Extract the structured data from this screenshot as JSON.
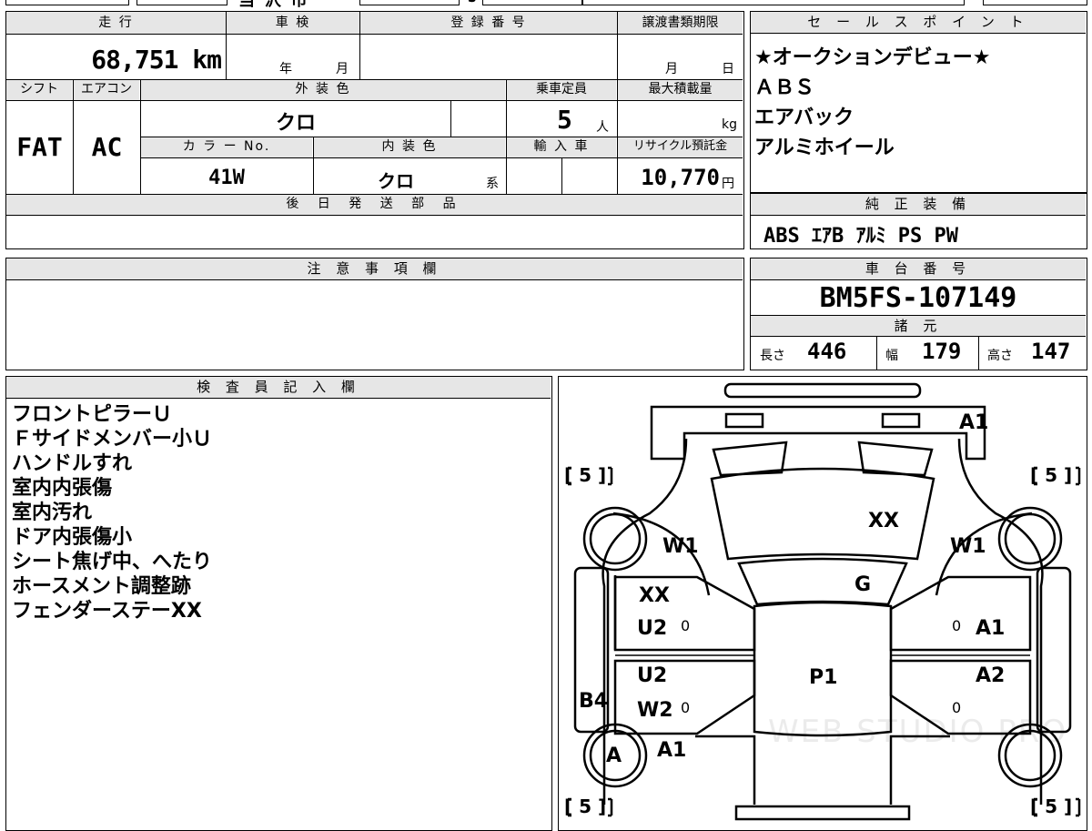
{
  "top_fragments": {
    "a": "当 沢 市",
    "b": "J"
  },
  "vehicle": {
    "mileage_label": "走 行",
    "mileage_value": "68,751 km",
    "inspection_label": "車 検",
    "inspection_year_unit": "年",
    "inspection_month_unit": "月",
    "registration_label": "登 録 番 号",
    "transfer_deadline_label": "譲渡書類期限",
    "transfer_month_unit": "月",
    "transfer_day_unit": "日",
    "shift_label": "シフト",
    "shift_value": "FAT",
    "aircon_label": "エアコン",
    "aircon_value": "AC",
    "exterior_color_label": "外 装 色",
    "exterior_color_value": "クロ",
    "capacity_label": "乗車定員",
    "capacity_value": "5",
    "capacity_unit": "人",
    "max_load_label": "最大積載量",
    "max_load_unit": "kg",
    "color_no_label": "カ ラ ー No.",
    "color_no_value": "41W",
    "interior_color_label": "内 装 色",
    "interior_color_value": "クロ",
    "interior_color_suffix": "系",
    "import_label": "輸 入 車",
    "recycle_label": "リサイクル預託金",
    "recycle_value": "10,770",
    "recycle_unit": "円",
    "later_parts_label": "後 日 発 送 部 品"
  },
  "notes": {
    "label": "注 意 事 項 欄"
  },
  "sales_points": {
    "label": "セ ー ル ス ポ イ ン ト",
    "items": [
      "★オークションデビュー★",
      "ＡＢＳ",
      "エアバック",
      "アルミホイール"
    ]
  },
  "genuine_equipment": {
    "label": "純 正 装 備",
    "value": "ABS ｴｱB ｱﾙﾐ PS PW"
  },
  "chassis": {
    "label": "車 台 番 号",
    "value": "BM5FS-107149"
  },
  "specs": {
    "label": "諸 元",
    "length_label": "長さ",
    "length_value": "446",
    "width_label": "幅",
    "width_value": "179",
    "height_label": "高さ",
    "height_value": "147"
  },
  "inspector": {
    "label": "検 査 員 記 入 欄",
    "lines": [
      "フロントピラーＵ",
      "Ｆサイドメンバー小Ｕ",
      "ハンドルすれ",
      "室内内張傷",
      "室内汚れ",
      "ドア内張傷小",
      "シート焦げ中、へたり",
      "ホースメント調整跡",
      "フェンダーステーXX"
    ]
  },
  "diagram": {
    "tire_fl": "[ 5 ]",
    "tire_fr": "[ 5 ]",
    "tire_rl": "[ 5 ]",
    "tire_rr": "[ 5 ]",
    "front_bumper": "A1",
    "hood": "XX",
    "fender_left": "W1",
    "fender_right": "W1",
    "windshield": "G",
    "door_fl": "XX",
    "door_fl_2": "U2",
    "door_fr": "A1",
    "door_rl": "U2",
    "door_rl_2": "W2",
    "door_rr": "A2",
    "roof": "P1",
    "pillar_left": "B4",
    "wheel_rl": "A",
    "quarter_rl": "A1",
    "zero_1": "0",
    "zero_2": "0",
    "zero_3": "0",
    "zero_4": "0",
    "watermark": "WEB STUDIO PRO"
  }
}
